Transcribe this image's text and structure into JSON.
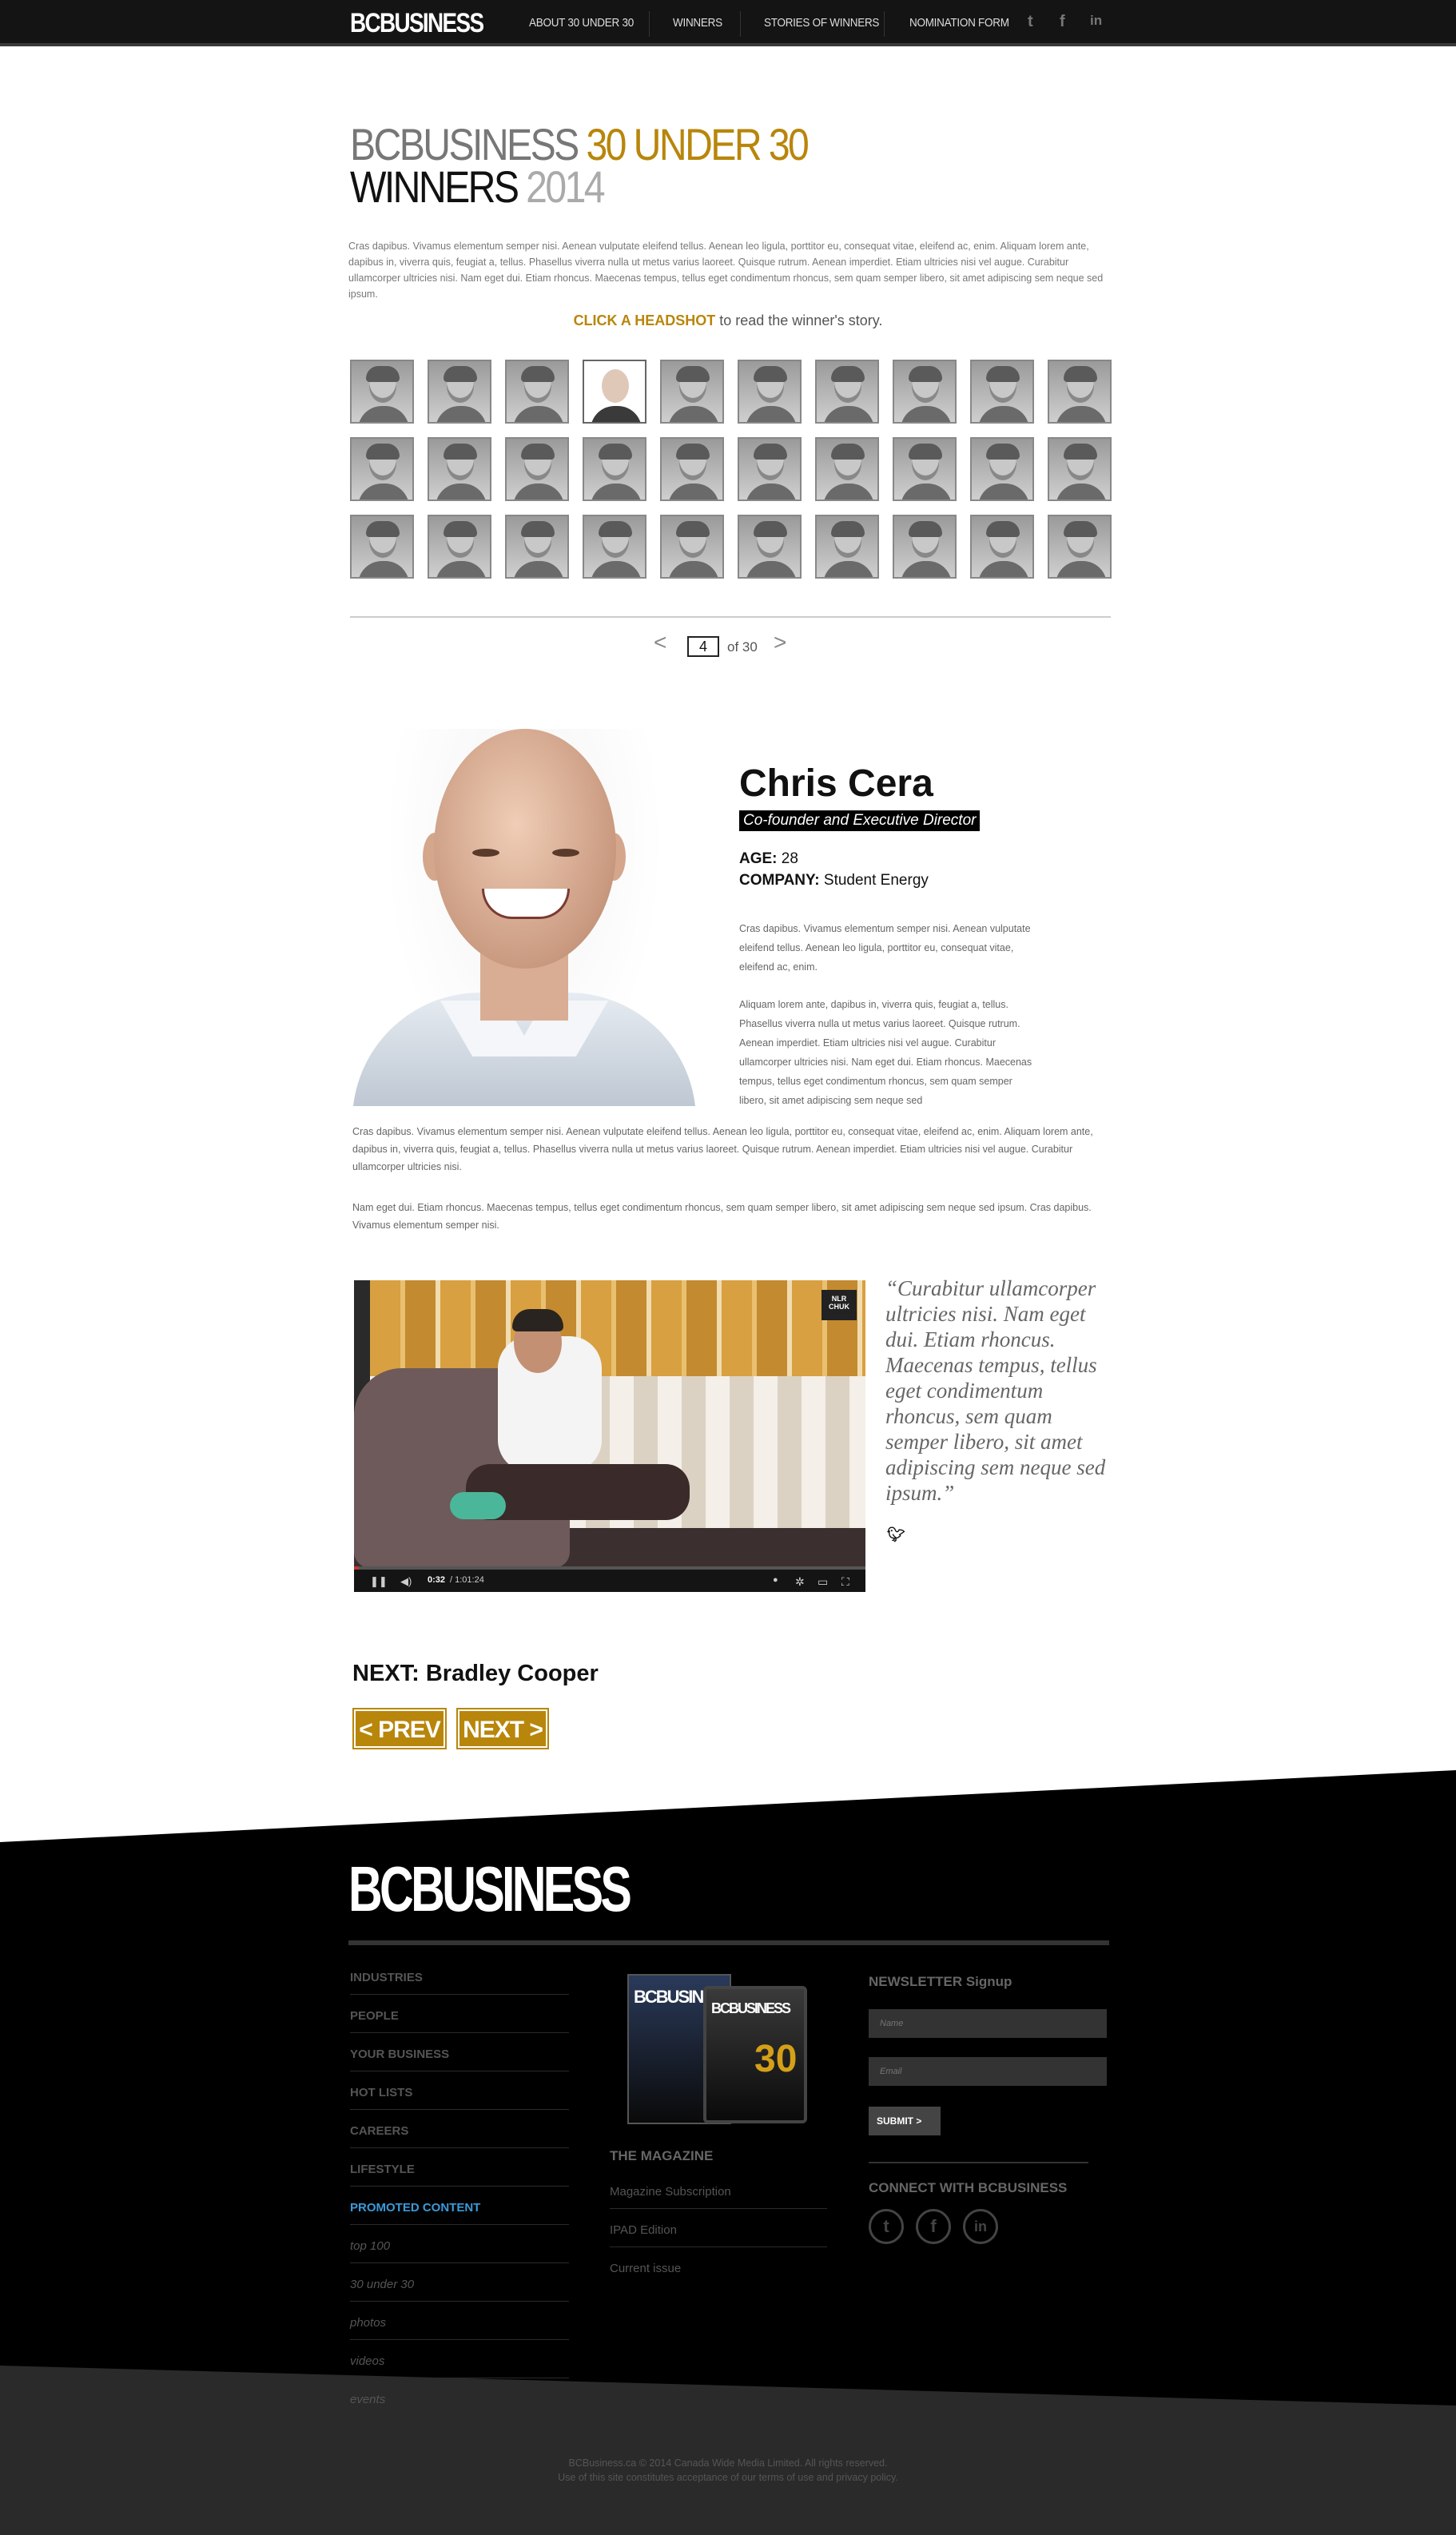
{
  "nav": {
    "logo": "BCBUSINESS",
    "links": [
      "ABOUT 30 UNDER 30",
      "WINNERS",
      "STORIES OF WINNERS",
      "NOMINATION FORM"
    ],
    "social": [
      "t",
      "f",
      "in"
    ]
  },
  "title": {
    "line1_a": "BCBUSINESS",
    "line1_b": "30 UNDER 30",
    "line2_a": "WINNERS",
    "line2_b": "2014"
  },
  "intro": "Cras dapibus. Vivamus elementum semper nisi. Aenean vulputate eleifend tellus. Aenean leo ligula, porttitor eu, consequat vitae, eleifend ac, enim. Aliquam lorem ante, dapibus in, viverra quis, feugiat a, tellus. Phasellus viverra nulla ut metus varius laoreet. Quisque rutrum. Aenean imperdiet. Etiam ultricies nisi vel augue. Curabitur ullamcorper ultricies nisi. Nam eget dui. Etiam rhoncus. Maecenas tempus, tellus eget condimentum rhoncus, sem quam semper libero, sit amet adipiscing sem neque sed ipsum.",
  "cta": {
    "highlight": "CLICK A HEADSHOT",
    "rest": " to read the winner's story."
  },
  "grid": {
    "count": 30,
    "active_index": 3
  },
  "pager": {
    "prev": "<",
    "current": "4",
    "of": "of 30",
    "next": ">"
  },
  "winner": {
    "name": "Chris Cera",
    "role": "Co-founder and Executive Director",
    "age_label": "AGE:",
    "age": "28",
    "company_label": "COMPANY:",
    "company": "Student Energy",
    "bio1": "Cras dapibus. Vivamus elementum semper nisi. Aenean vulputate eleifend tellus. Aenean leo ligula, porttitor eu, consequat vitae, eleifend ac, enim.",
    "bio2": "Aliquam lorem ante, dapibus in, viverra quis, feugiat a, tellus. Phasellus viverra nulla ut metus varius laoreet. Quisque rutrum. Aenean imperdiet. Etiam ultricies nisi vel augue. Curabitur ullamcorper ultricies nisi. Nam eget dui. Etiam rhoncus. Maecenas tempus, tellus eget condimentum rhoncus, sem quam semper libero, sit amet adipiscing sem neque sed",
    "bio3": "Cras dapibus. Vivamus elementum semper nisi. Aenean vulputate eleifend tellus. Aenean leo ligula, porttitor eu, consequat vitae, eleifend ac, enim. Aliquam lorem ante, dapibus in, viverra quis, feugiat a, tellus. Phasellus viverra nulla ut metus varius laoreet. Quisque rutrum. Aenean imperdiet. Etiam ultricies nisi vel augue. Curabitur ullamcorper ultricies nisi.",
    "bio4": "Nam eget dui. Etiam rhoncus. Maecenas tempus, tellus eget condimentum rhoncus, sem quam semper libero, sit amet adipiscing sem neque sed ipsum. Cras dapibus. Vivamus elementum semper nisi."
  },
  "video": {
    "label": "NLR CHUK",
    "time_current": "0:32",
    "time_total": "/ 1:01:24",
    "progress": 0.01
  },
  "quote": {
    "text": "“Curabitur ullamcorper ultricies nisi. Nam eget dui. Etiam rhoncus. Maecenas tempus, tellus eget condimentum rhoncus, sem quam semper libero, sit amet adipiscing sem neque sed ipsum.”",
    "icon": "twitter-icon"
  },
  "next_nav": {
    "title": "NEXT: Bradley Cooper",
    "prev_label": "< PREV",
    "next_label": "NEXT >"
  },
  "footer": {
    "logo": "BCBUSINESS",
    "links": [
      "INDUSTRIES",
      "PEOPLE",
      "YOUR BUSINESS",
      "HOT LISTS",
      "CAREERS",
      "LIFESTYLE",
      "PROMOTED CONTENT",
      "top 100",
      "30 under 30",
      "photos",
      "videos",
      "events"
    ],
    "magazine_cover_title": "BCBUSINESS",
    "magazine_cover_number": "30",
    "magazine_heading": "THE MAGAZINE",
    "magazine_links": [
      "Magazine Subscription",
      "IPAD Edition",
      "Current issue"
    ],
    "newsletter_heading": "NEWSLETTER Signup",
    "name_placeholder": "Name",
    "email_placeholder": "Email",
    "submit": "SUBMIT >",
    "connect_heading": "CONNECT WITH BCBUSINESS",
    "social": [
      "t",
      "f",
      "in"
    ],
    "copyright": "BCBusiness.ca © 2014 Canada Wide Media Limited. All rights reserved.",
    "terms": "Use of this site constitutes acceptance of our terms of use and privacy policy."
  },
  "colors": {
    "accent": "#b8860b",
    "promoted": "#3a9ad9"
  }
}
